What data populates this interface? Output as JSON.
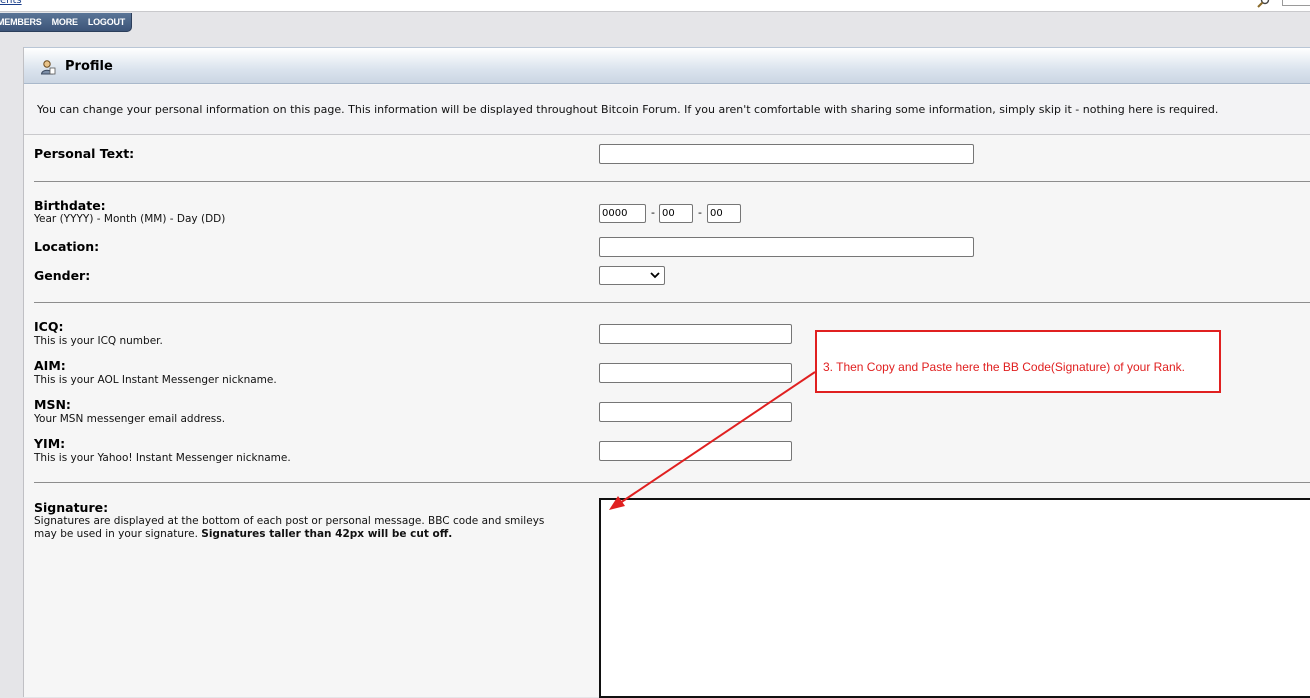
{
  "top": {
    "link": "ents"
  },
  "nav": {
    "items": [
      "MEMBERS",
      "MORE",
      "LOGOUT"
    ]
  },
  "panel": {
    "title": "Profile",
    "intro": "You can change your personal information on this page. This information will be displayed throughout Bitcoin Forum. If you aren't comfortable with sharing some information, simply skip it - nothing here is required."
  },
  "fields": {
    "personal_text": {
      "label": "Personal Text:",
      "value": ""
    },
    "birthdate": {
      "label": "Birthdate:",
      "desc": "Year (YYYY) - Month (MM) - Day (DD)",
      "year": "0000",
      "month": "00",
      "day": "00",
      "sep": "-"
    },
    "location": {
      "label": "Location:",
      "value": ""
    },
    "gender": {
      "label": "Gender:",
      "selected": ""
    },
    "icq": {
      "label": "ICQ:",
      "desc": "This is your ICQ number.",
      "value": ""
    },
    "aim": {
      "label": "AIM:",
      "desc": "This is your AOL Instant Messenger nickname.",
      "value": ""
    },
    "msn": {
      "label": "MSN:",
      "desc": "Your MSN messenger email address.",
      "value": ""
    },
    "yim": {
      "label": "YIM:",
      "desc": "This is your Yahoo! Instant Messenger nickname.",
      "value": ""
    },
    "signature": {
      "label": "Signature:",
      "desc_line1": "Signatures are displayed at the bottom of each post or personal message. BBC code and smileys",
      "desc_line2": "may be used in your signature.",
      "desc_bold": "Signatures taller than 42px will be cut off.",
      "value": ""
    }
  },
  "annotation": {
    "text": "3. Then Copy and Paste here the BB Code(Signature) of your Rank.",
    "color": "#e02020"
  },
  "colors": {
    "nav_bg": "#4a6588",
    "panel_bg": "#f6f6f6",
    "header_grad": "#cbd6e3"
  }
}
